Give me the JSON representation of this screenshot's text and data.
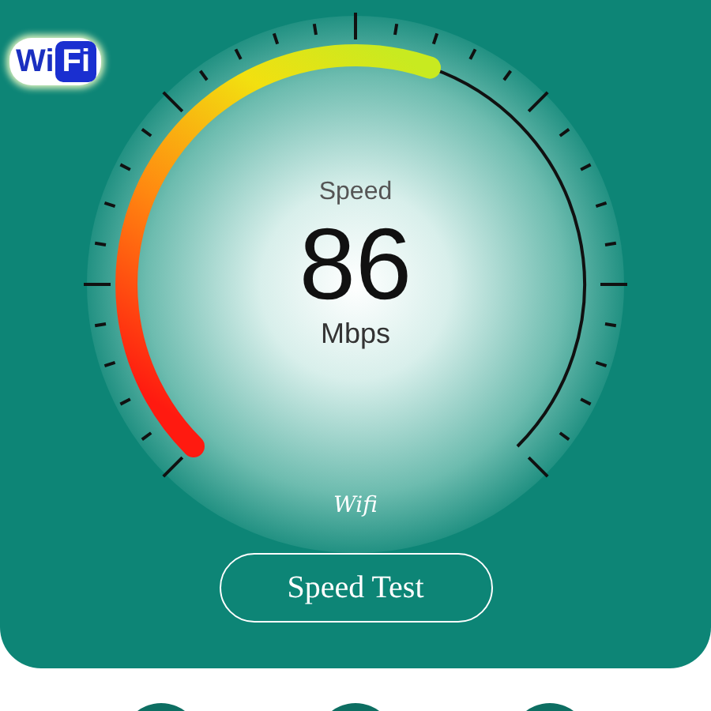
{
  "logo": {
    "left": "Wi",
    "right": "Fi"
  },
  "gauge": {
    "label": "Speed",
    "value": "86",
    "unit": "Mbps"
  },
  "network": "Wifi",
  "button": "Speed Test"
}
